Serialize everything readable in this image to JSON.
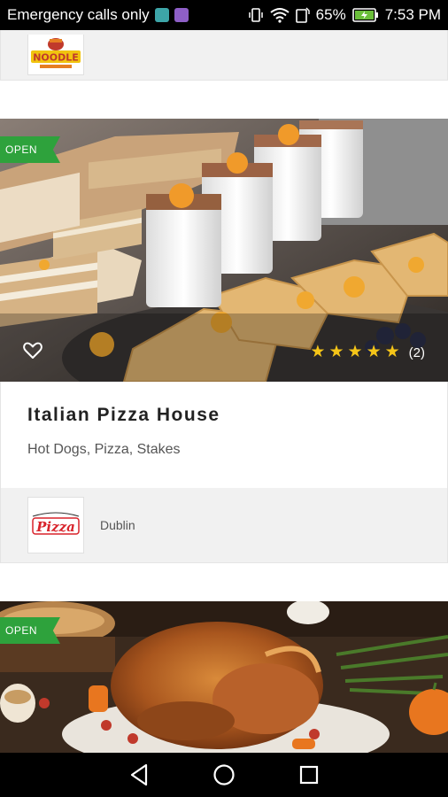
{
  "status_bar": {
    "carrier": "Emergency calls only",
    "battery": "65%",
    "time": "7:53 PM"
  },
  "top_card": {
    "logo_lines": [
      "NOODLE"
    ]
  },
  "restaurants": [
    {
      "badge": "OPEN",
      "name": "Italian Pizza House",
      "tags": "Hot Dogs, Pizza, Stakes",
      "rating_stars": 5,
      "rating_count": "(2)",
      "location": "Dublin",
      "logo_text": "Pizza"
    },
    {
      "badge": "OPEN"
    }
  ],
  "colors": {
    "open_badge": "#2ea23c",
    "star": "#f5c518",
    "footer_bg": "#f1f1f1",
    "pizza_logo_red": "#d8222a"
  },
  "icons": [
    "heart-outline-icon",
    "star-icon",
    "back-icon",
    "home-icon",
    "recents-icon",
    "wifi-icon",
    "battery-icon",
    "vibrate-icon"
  ]
}
